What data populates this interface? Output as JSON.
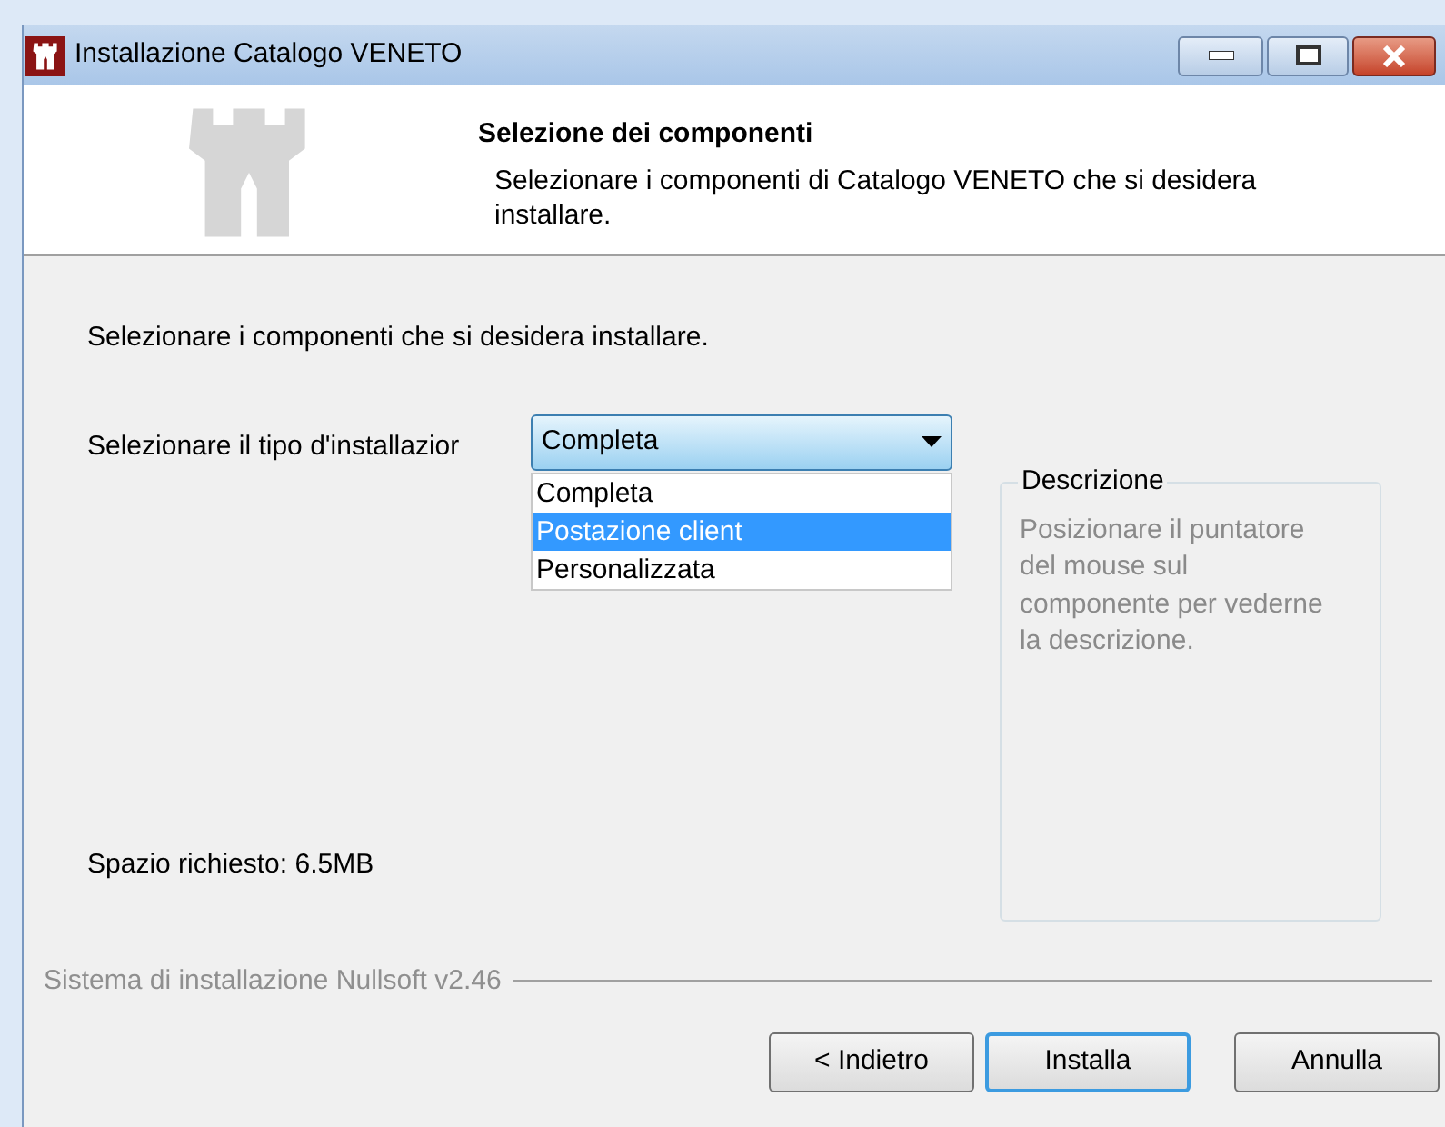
{
  "window": {
    "title": "Installazione Catalogo VENETO"
  },
  "header": {
    "title": "Selezione dei componenti",
    "subtitle": "Selezionare i componenti di Catalogo VENETO che si desidera installare."
  },
  "intro": "Selezionare i componenti che si desidera installare.",
  "install_type": {
    "label": "Selezionare il tipo d'installazior",
    "value": "Completa",
    "expanded": true,
    "options": [
      {
        "label": "Completa",
        "highlighted": false
      },
      {
        "label": "Postazione client",
        "highlighted": true
      },
      {
        "label": "Personalizzata",
        "highlighted": false
      }
    ]
  },
  "description": {
    "title": "Descrizione",
    "text": "Posizionare il puntatore del mouse sul componente per vederne la descrizione."
  },
  "space_required": "Spazio richiesto: 6.5MB",
  "branding": "Sistema di installazione Nullsoft v2.46",
  "buttons": [
    {
      "label": "< Indietro",
      "focused": false
    },
    {
      "label": "Installa",
      "focused": true
    },
    {
      "label": "Annulla",
      "focused": false
    }
  ]
}
